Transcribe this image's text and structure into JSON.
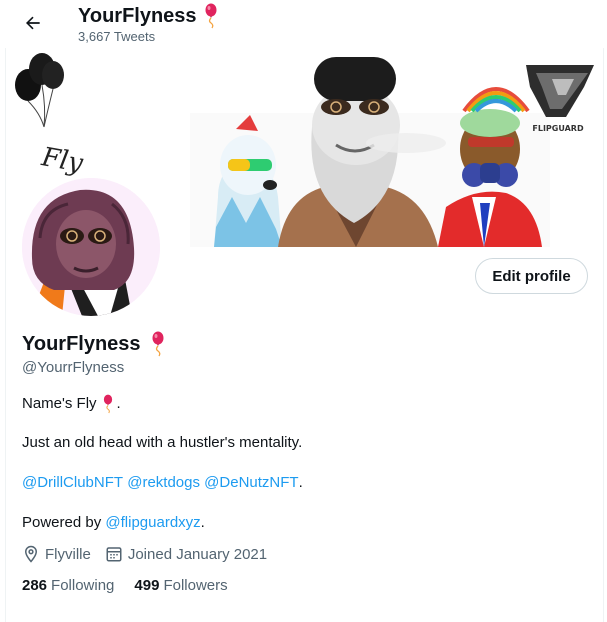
{
  "header": {
    "name": "YourFlyness",
    "tweet_count": "3,667 Tweets"
  },
  "banner": {
    "left_text": "Fly",
    "logo_text": "FLIPGUARD"
  },
  "profile": {
    "edit_button": "Edit profile",
    "name": "YourFlyness",
    "handle": "@YourrFlyness"
  },
  "bio": {
    "line1_text": "Name's Fly",
    "line1_end": ".",
    "line2": "Just an old head with a hustler's mentality.",
    "mentions": [
      "@DrillClubNFT",
      "@rektdogs",
      "@DeNutzNFT"
    ],
    "line3_end": ".",
    "powered_prefix": "Powered by",
    "powered_link": "@flipguardxyz",
    "powered_end": "."
  },
  "meta": {
    "location": "Flyville",
    "joined": "Joined January 2021"
  },
  "stats": {
    "following_count": "286",
    "following_label": "Following",
    "followers_count": "499",
    "followers_label": "Followers"
  },
  "colors": {
    "accent": "#1d9bf0",
    "muted": "#536471",
    "balloon": "#e0245e"
  }
}
